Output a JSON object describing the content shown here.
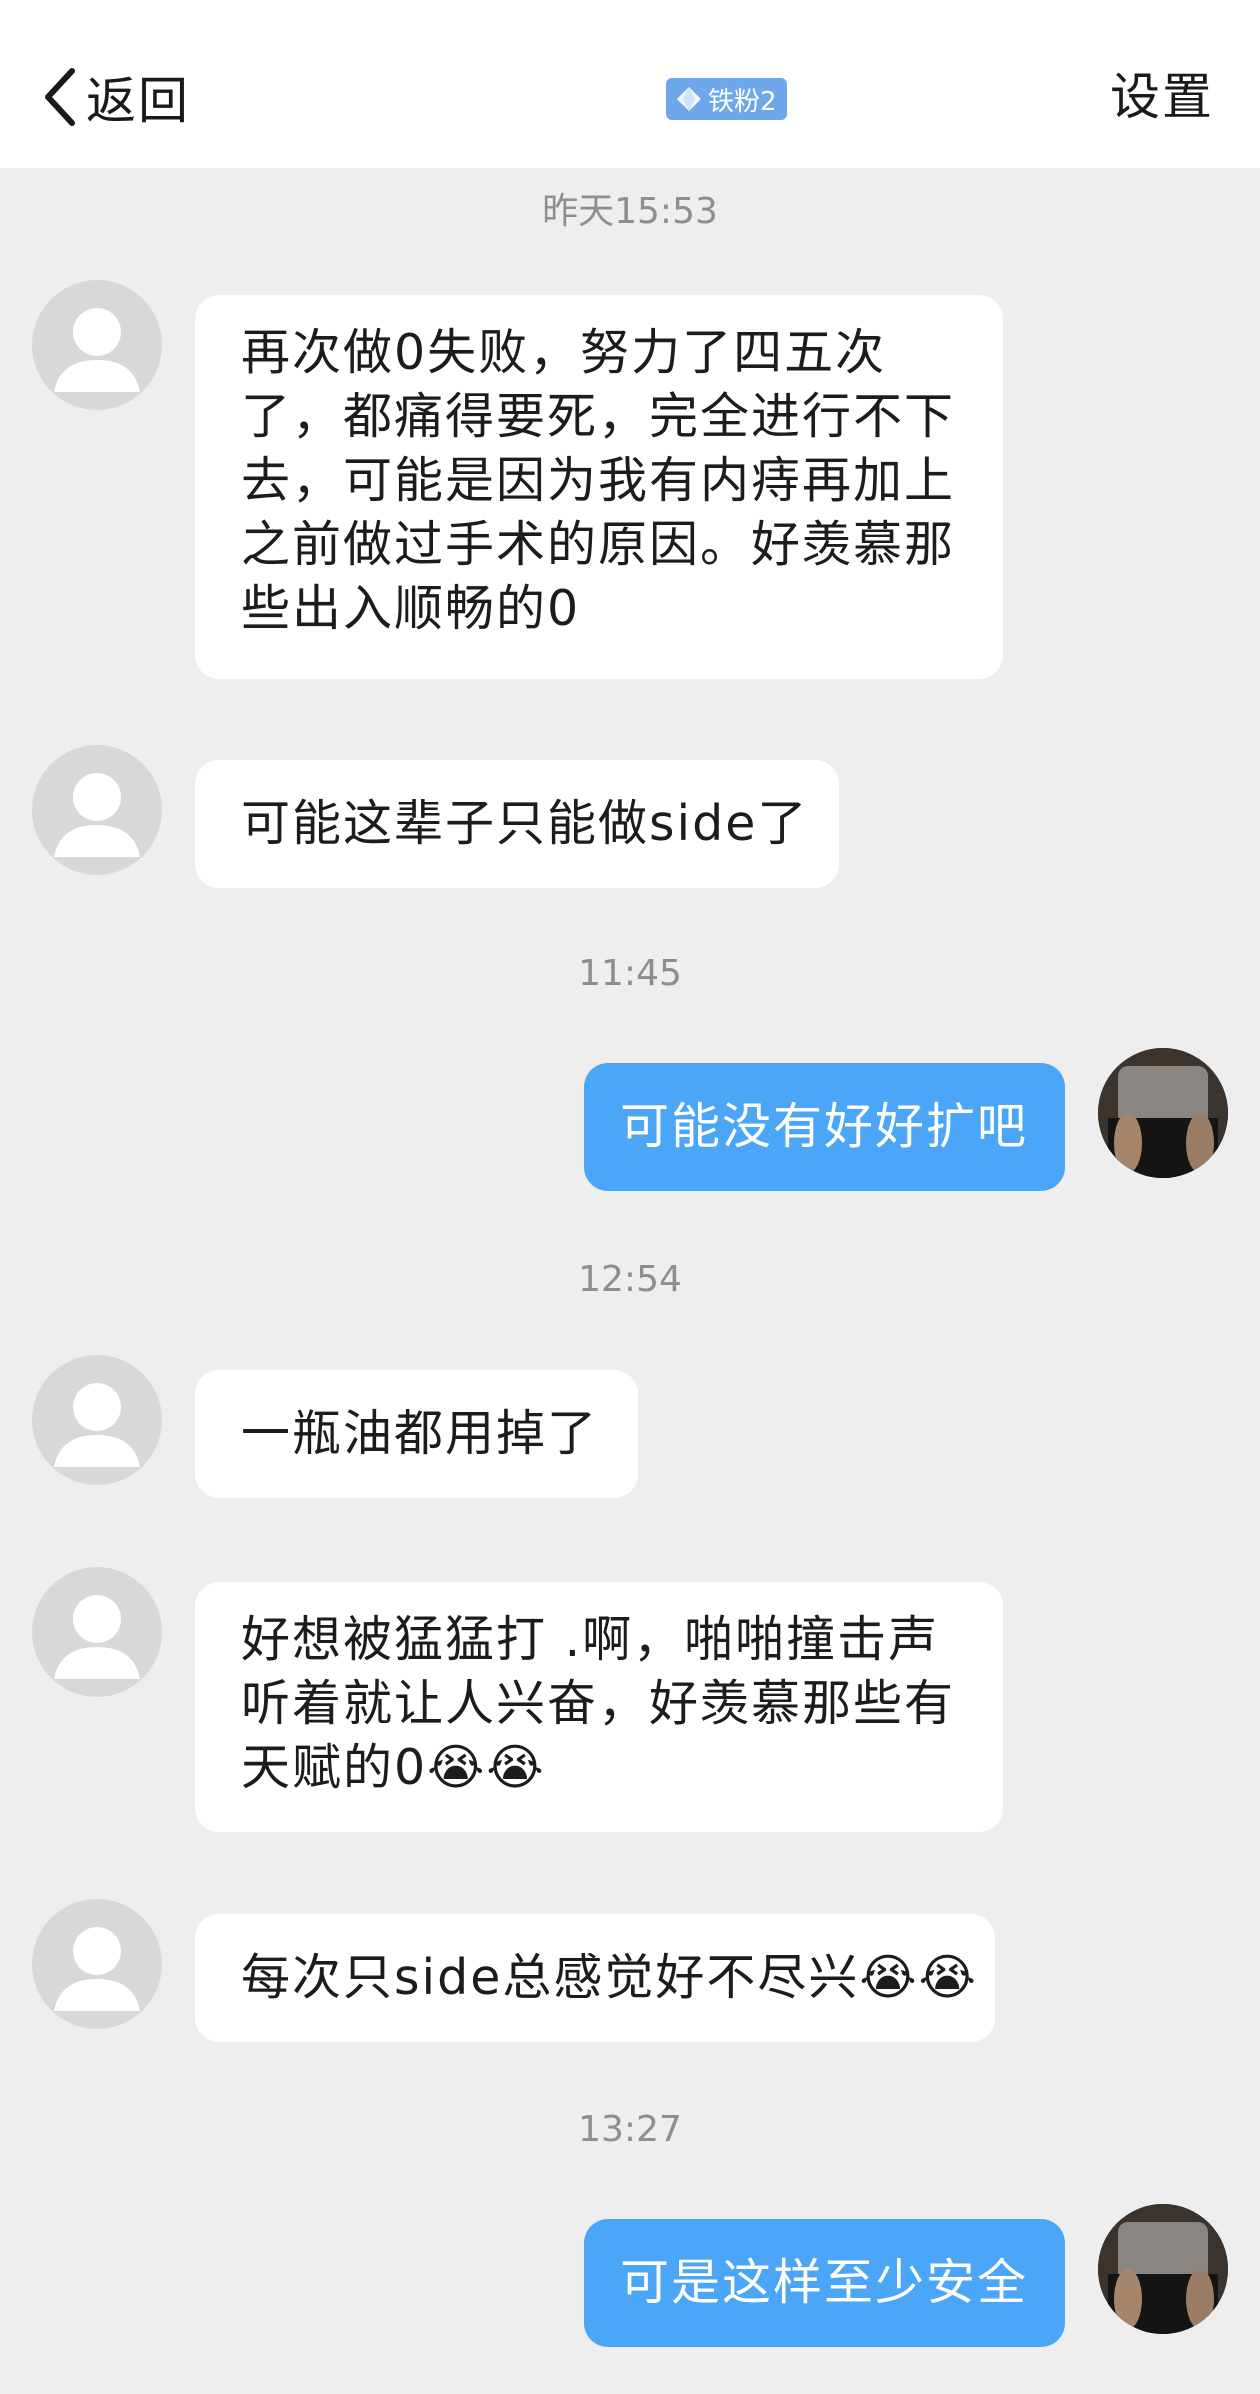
{
  "header": {
    "back_label": "返回",
    "badge_label": "铁粉2",
    "settings_label": "设置"
  },
  "timestamps": [
    "昨天15:53",
    "11:45",
    "12:54",
    "13:27"
  ],
  "messages": [
    {
      "side": "in",
      "text": "再次做0失败，努力了四五次\n了，都痛得要死，完全进行不下\n去，可能是因为我有内痔再加上\n之前做过手术的原因。好羡慕那\n些出入顺畅的0"
    },
    {
      "side": "in",
      "text": "可能这辈子只能做side了"
    },
    {
      "side": "out",
      "text": "可能没有好好扩吧"
    },
    {
      "side": "in",
      "text": "一瓶油都用掉了"
    },
    {
      "side": "in",
      "text": "好想被猛猛打 .啊，啪啪撞击声\n听着就让人兴奋，好羡慕那些有\n天赋的0😭😭"
    },
    {
      "side": "in",
      "text": "每次只side总感觉好不尽兴😭😭"
    },
    {
      "side": "out",
      "text": "可是这样至少安全"
    }
  ],
  "colors": {
    "background": "#eeeeee",
    "incoming_bubble": "#ffffff",
    "outgoing_bubble": "#4ba6f7",
    "badge": "#6fa8ea",
    "timestamp": "#8e8e8e"
  }
}
